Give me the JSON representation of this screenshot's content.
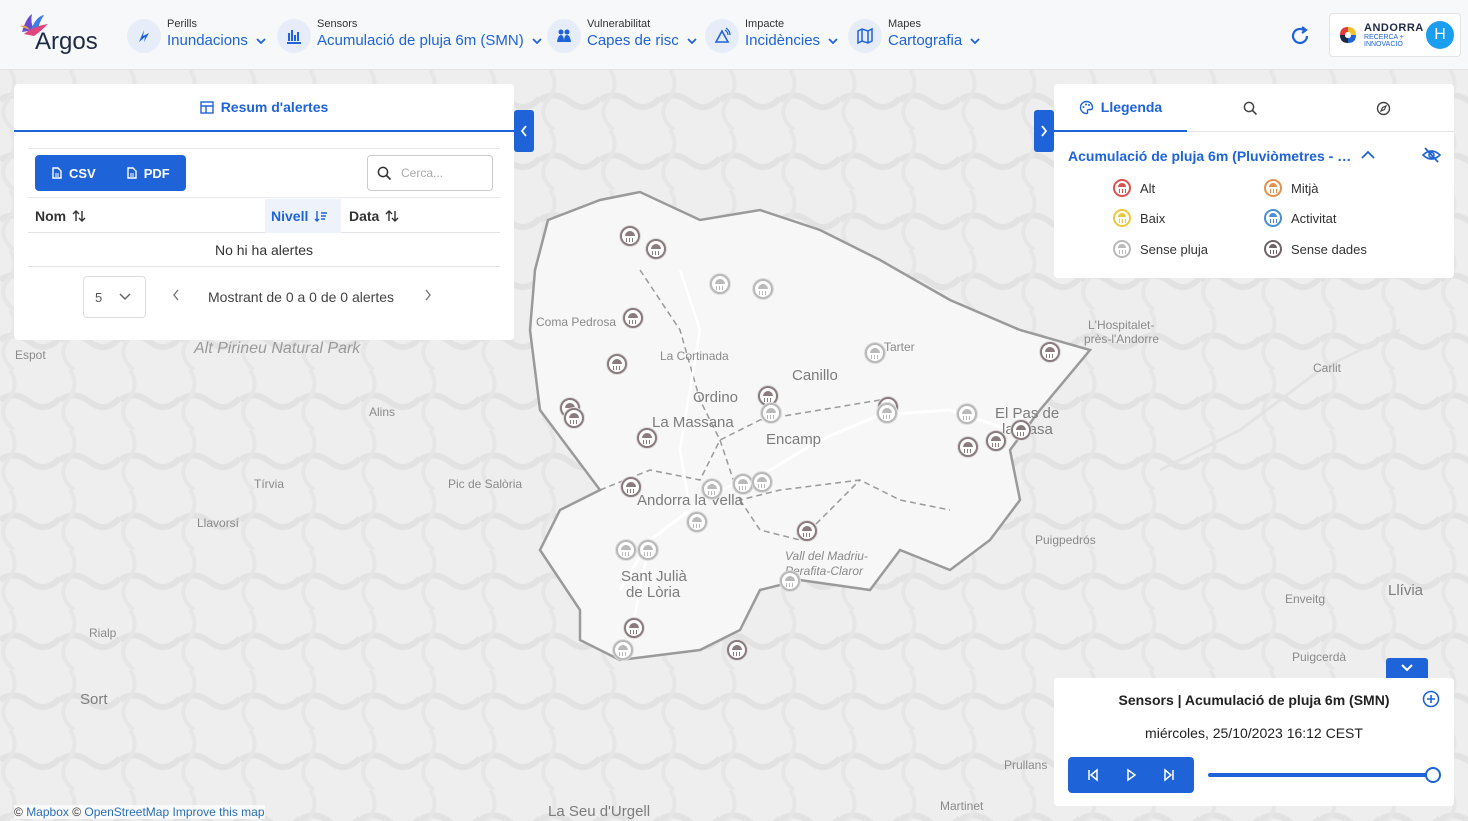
{
  "app": {
    "name": "Argos"
  },
  "nav": [
    {
      "small": "Perills",
      "big": "Inundacions"
    },
    {
      "small": "Sensors",
      "big": "Acumulació de pluja 6m (SMN)"
    },
    {
      "small": "Vulnerabilitat",
      "big": "Capes de risc"
    },
    {
      "small": "Impacte",
      "big": "Incidències"
    },
    {
      "small": "Mapes",
      "big": "Cartografia"
    }
  ],
  "brand": {
    "line1": "ANDORRA",
    "line2": "RECERCA +",
    "line3": "INNOVACIÓ",
    "avatar_initial": "H"
  },
  "alerts": {
    "tab_label": "Resum d'alertes",
    "csv_label": "CSV",
    "pdf_label": "PDF",
    "search_placeholder": "Cerca...",
    "columns": [
      "Nom",
      "Nivell",
      "Data"
    ],
    "sorted_column": "Nivell",
    "empty_message": "No hi ha alertes",
    "page_size": "5",
    "pager_text": "Mostrant de 0 a 0 de 0 alertes"
  },
  "legend": {
    "tab_label": "Llegenda",
    "layer_title": "Acumulació de pluja 6m (Pluviòmetres - SMN)",
    "items": [
      {
        "label": "Alt",
        "color": "#d9534f"
      },
      {
        "label": "Mitjà",
        "color": "#e8904a"
      },
      {
        "label": "Baix",
        "color": "#e9c93a"
      },
      {
        "label": "Activitat",
        "color": "#4a8fd6"
      },
      {
        "label": "Sense pluja",
        "color": "#b9b9b9"
      },
      {
        "label": "Sense dades",
        "color": "#6e6467"
      }
    ]
  },
  "player": {
    "title": "Sensors | Acumulació de pluja 6m (SMN)",
    "datetime": "miércoles, 25/10/2023 16:12 CEST",
    "slider_position": 1.0
  },
  "map": {
    "labels": [
      "Coma Pedrosa",
      "La Cortinada",
      "Ordino",
      "Canillo",
      "La Massana",
      "Encamp",
      "El Pas de",
      "la Casa",
      "Tarter",
      "Andorra la Vella",
      "Sant Julià",
      "de Lòria",
      "Vall del Madriu-",
      "Perafita-Claror",
      "Pic de Salòria",
      "Alt Pirineu Natural Park",
      "Espot",
      "Alins",
      "Tírvia",
      "Llavorsí",
      "Rialp",
      "Sort",
      "Carlit",
      "Puigcerdà",
      "Llívia",
      "Enveitg",
      "Puigpedrós",
      "Prullans",
      "Martinet",
      "La Seu d'Urgell",
      "L'Hospitalet-",
      "près-l'Andorre"
    ],
    "attribution": {
      "prefix": "©",
      "mapbox": "Mapbox",
      "sep": "©",
      "osm": "OpenStreetMap",
      "improve": "Improve this map"
    }
  },
  "colors": {
    "accent": "#1e63d8",
    "avatar": "#1a9ef0"
  }
}
